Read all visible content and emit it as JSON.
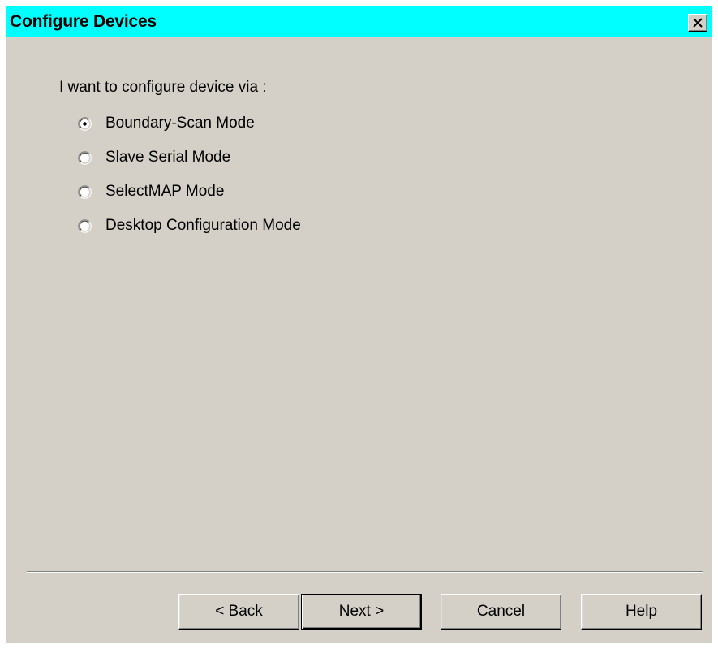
{
  "window": {
    "title": "Configure Devices",
    "close_label": "×"
  },
  "prompt": "I want to configure device via :",
  "options": [
    {
      "label": "Boundary-Scan Mode",
      "selected": true
    },
    {
      "label": "Slave Serial Mode",
      "selected": false
    },
    {
      "label": "SelectMAP Mode",
      "selected": false
    },
    {
      "label": "Desktop Configuration Mode",
      "selected": false
    }
  ],
  "buttons": {
    "back": "< Back",
    "next": "Next >",
    "cancel": "Cancel",
    "help": "Help"
  },
  "colors": {
    "titlebar": "#00ffff",
    "dialog_bg": "#d4d0c8"
  }
}
